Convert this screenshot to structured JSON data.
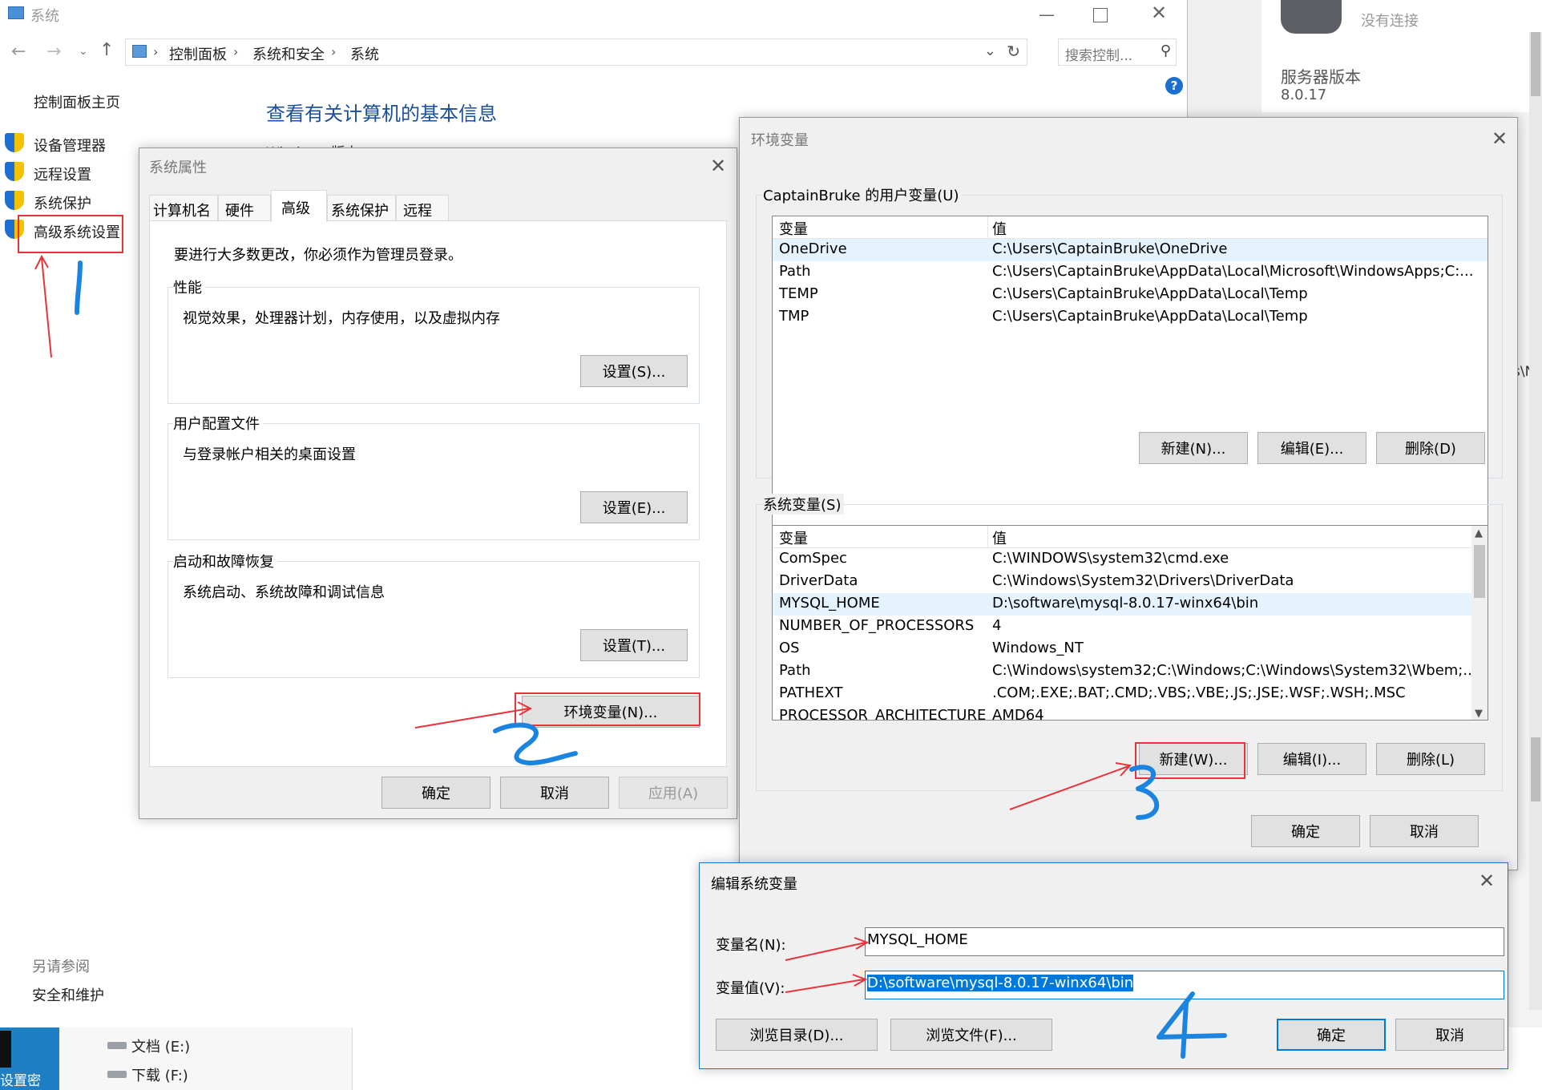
{
  "system_window": {
    "title": "系统",
    "breadcrumb": [
      "控制面板",
      "系统和安全",
      "系统"
    ],
    "search_placeholder": "搜索控制...",
    "home_link": "控制面板主页",
    "nav_items": [
      "设备管理器",
      "远程设置",
      "系统保护",
      "高级系统设置"
    ],
    "page_heading": "查看有关计算机的基本信息",
    "partial_text": "Windows 版本",
    "see_also": "另请参阅",
    "see_also_link": "安全和维护",
    "drives": [
      "文档 (E:)",
      "下载 (F:)"
    ],
    "taskbar_text": "设置密"
  },
  "server_panel": {
    "status": "没有连接",
    "version_label": "服务器版本",
    "version": "8.0.17",
    "partial_text": "s\\N"
  },
  "sys_props": {
    "title": "系统属性",
    "tabs": [
      "计算机名",
      "硬件",
      "高级",
      "系统保护",
      "远程"
    ],
    "active_tab": "高级",
    "admin_note": "要进行大多数更改，你必须作为管理员登录。",
    "groups": [
      {
        "label": "性能",
        "desc": "视觉效果，处理器计划，内存使用，以及虚拟内存",
        "button": "设置(S)..."
      },
      {
        "label": "用户配置文件",
        "desc": "与登录帐户相关的桌面设置",
        "button": "设置(E)..."
      },
      {
        "label": "启动和故障恢复",
        "desc": "系统启动、系统故障和调试信息",
        "button": "设置(T)..."
      }
    ],
    "env_button": "环境变量(N)...",
    "ok": "确定",
    "cancel": "取消",
    "apply": "应用(A)"
  },
  "env_vars": {
    "title": "环境变量",
    "user_group": "CaptainBruke 的用户变量(U)",
    "col_var": "变量",
    "col_val": "值",
    "user_rows": [
      {
        "name": "OneDrive",
        "value": "C:\\Users\\CaptainBruke\\OneDrive"
      },
      {
        "name": "Path",
        "value": "C:\\Users\\CaptainBruke\\AppData\\Local\\Microsoft\\WindowsApps;C:..."
      },
      {
        "name": "TEMP",
        "value": "C:\\Users\\CaptainBruke\\AppData\\Local\\Temp"
      },
      {
        "name": "TMP",
        "value": "C:\\Users\\CaptainBruke\\AppData\\Local\\Temp"
      }
    ],
    "user_buttons": [
      "新建(N)...",
      "编辑(E)...",
      "删除(D)"
    ],
    "sys_group": "系统变量(S)",
    "sys_rows": [
      {
        "name": "ComSpec",
        "value": "C:\\WINDOWS\\system32\\cmd.exe"
      },
      {
        "name": "DriverData",
        "value": "C:\\Windows\\System32\\Drivers\\DriverData"
      },
      {
        "name": "MYSQL_HOME",
        "value": "D:\\software\\mysql-8.0.17-winx64\\bin"
      },
      {
        "name": "NUMBER_OF_PROCESSORS",
        "value": "4"
      },
      {
        "name": "OS",
        "value": "Windows_NT"
      },
      {
        "name": "Path",
        "value": "C:\\Windows\\system32;C:\\Windows;C:\\Windows\\System32\\Wbem;..."
      },
      {
        "name": "PATHEXT",
        "value": ".COM;.EXE;.BAT;.CMD;.VBS;.VBE;.JS;.JSE;.WSF;.WSH;.MSC"
      },
      {
        "name": "PROCESSOR_ARCHITECTURE",
        "value": "AMD64"
      }
    ],
    "sys_buttons": [
      "新建(W)...",
      "编辑(I)...",
      "删除(L)"
    ],
    "ok": "确定",
    "cancel": "取消"
  },
  "edit_var": {
    "title": "编辑系统变量",
    "name_label": "变量名(N):",
    "name_value": "MYSQL_HOME",
    "value_label": "变量值(V):",
    "value_value": "D:\\software\\mysql-8.0.17-winx64\\bin",
    "browse_dir": "浏览目录(D)...",
    "browse_file": "浏览文件(F)...",
    "ok": "确定",
    "cancel": "取消"
  },
  "colors": {
    "annotation_red": "#e8333a",
    "annotation_blue": "#1b84e0",
    "link_blue": "#1a5fb4",
    "selection": "#0078d7"
  }
}
